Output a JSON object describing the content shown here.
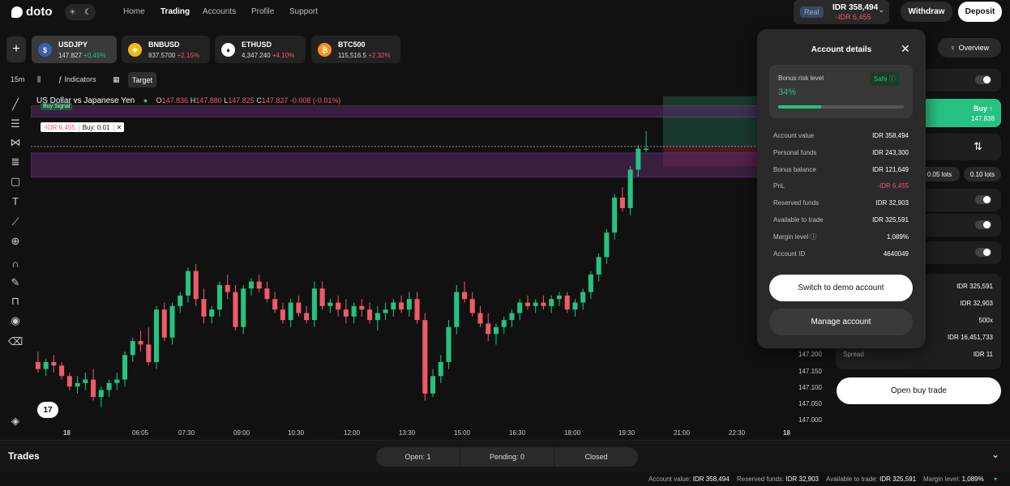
{
  "app": {
    "name": "doto"
  },
  "nav": {
    "items": [
      {
        "label": "Home",
        "active": false
      },
      {
        "label": "Trading",
        "active": true
      },
      {
        "label": "Accounts",
        "active": false
      },
      {
        "label": "Profile",
        "active": false
      },
      {
        "label": "Support",
        "active": false
      }
    ]
  },
  "account": {
    "type": "Real",
    "value": "IDR 358,494",
    "pnl": "-IDR 6,455"
  },
  "header": {
    "withdraw": "Withdraw",
    "deposit": "Deposit"
  },
  "instruments": [
    {
      "symbol": "USDJPY",
      "price": "147.827",
      "change": "+0.45%",
      "change_positive": true,
      "active": true,
      "icon": "us-jp-flag-icon",
      "color": "#3c5fb0"
    },
    {
      "symbol": "BNBUSD",
      "price": "837.5700",
      "change": "+2.15%",
      "change_positive": false,
      "active": false,
      "icon": "bnb-icon",
      "color": "#f0b90b"
    },
    {
      "symbol": "ETHUSD",
      "price": "4,347.240",
      "change": "+4.10%",
      "change_positive": false,
      "active": false,
      "icon": "eth-icon",
      "color": "#ffffff"
    },
    {
      "symbol": "BTC500",
      "price": "115,516.5",
      "change": "+2.32%",
      "change_positive": false,
      "active": false,
      "icon": "btc-icon",
      "color": "#f7931a"
    }
  ],
  "chart_toolbar": {
    "timeframe": "15m",
    "indicators": "Indicators",
    "target": "Target"
  },
  "chart_data": {
    "type": "candlestick",
    "title": "US Dollar vs Japanese Yen",
    "ohlc_label": {
      "o": "147.836",
      "h": "147.880",
      "l": "147.825",
      "c": "147.827",
      "change": "-0.008 (-0.01%)"
    },
    "ylim": [
      147.0,
      148.0
    ],
    "y_ticks": [
      "147.200",
      "147.150",
      "147.100",
      "147.050",
      "147.000"
    ],
    "x_ticks": [
      "18",
      "06:05",
      "07:30",
      "09:00",
      "10:30",
      "12:00",
      "13:30",
      "15:00",
      "16:30",
      "18:00",
      "19:30",
      "21:00",
      "22:30",
      "18"
    ],
    "candles": [
      [
        147.22,
        147.25,
        147.19,
        147.2
      ],
      [
        147.2,
        147.23,
        147.18,
        147.22
      ],
      [
        147.22,
        147.24,
        147.19,
        147.21
      ],
      [
        147.21,
        147.22,
        147.17,
        147.18
      ],
      [
        147.18,
        147.19,
        147.14,
        147.15
      ],
      [
        147.15,
        147.18,
        147.13,
        147.16
      ],
      [
        147.16,
        147.19,
        147.14,
        147.17
      ],
      [
        147.17,
        147.2,
        147.11,
        147.12
      ],
      [
        147.12,
        147.15,
        147.09,
        147.14
      ],
      [
        147.14,
        147.17,
        147.12,
        147.16
      ],
      [
        147.16,
        147.19,
        147.14,
        147.17
      ],
      [
        147.17,
        147.25,
        147.15,
        147.24
      ],
      [
        147.24,
        147.29,
        147.22,
        147.28
      ],
      [
        147.28,
        147.31,
        147.25,
        147.27
      ],
      [
        147.27,
        147.32,
        147.21,
        147.22
      ],
      [
        147.22,
        147.38,
        147.2,
        147.37
      ],
      [
        147.37,
        147.39,
        147.28,
        147.29
      ],
      [
        147.29,
        147.39,
        147.27,
        147.38
      ],
      [
        147.38,
        147.42,
        147.36,
        147.41
      ],
      [
        147.41,
        147.49,
        147.39,
        147.48
      ],
      [
        147.48,
        147.5,
        147.38,
        147.4
      ],
      [
        147.4,
        147.43,
        147.33,
        147.35
      ],
      [
        147.35,
        147.38,
        147.33,
        147.37
      ],
      [
        147.37,
        147.45,
        147.35,
        147.44
      ],
      [
        147.44,
        147.47,
        147.4,
        147.42
      ],
      [
        147.42,
        147.44,
        147.31,
        147.32
      ],
      [
        147.32,
        147.44,
        147.3,
        147.43
      ],
      [
        147.43,
        147.46,
        147.41,
        147.45
      ],
      [
        147.45,
        147.47,
        147.42,
        147.43
      ],
      [
        147.43,
        147.45,
        147.39,
        147.4
      ],
      [
        147.4,
        147.42,
        147.36,
        147.37
      ],
      [
        147.37,
        147.39,
        147.33,
        147.34
      ],
      [
        147.34,
        147.4,
        147.32,
        147.39
      ],
      [
        147.39,
        147.41,
        147.35,
        147.36
      ],
      [
        147.36,
        147.38,
        147.33,
        147.34
      ],
      [
        147.34,
        147.45,
        147.32,
        147.43
      ],
      [
        147.43,
        147.45,
        147.37,
        147.38
      ],
      [
        147.38,
        147.4,
        147.36,
        147.39
      ],
      [
        147.39,
        147.41,
        147.35,
        147.37
      ],
      [
        147.37,
        147.4,
        147.33,
        147.35
      ],
      [
        147.35,
        147.39,
        147.33,
        147.38
      ],
      [
        147.38,
        147.4,
        147.35,
        147.37
      ],
      [
        147.37,
        147.39,
        147.33,
        147.34
      ],
      [
        147.34,
        147.38,
        147.31,
        147.36
      ],
      [
        147.36,
        147.39,
        147.34,
        147.37
      ],
      [
        147.37,
        147.4,
        147.35,
        147.39
      ],
      [
        147.39,
        147.41,
        147.36,
        147.37
      ],
      [
        147.37,
        147.42,
        147.35,
        147.4
      ],
      [
        147.4,
        147.42,
        147.33,
        147.34
      ],
      [
        147.34,
        147.36,
        147.11,
        147.13
      ],
      [
        147.13,
        147.2,
        147.12,
        147.18
      ],
      [
        147.18,
        147.24,
        147.16,
        147.22
      ],
      [
        147.22,
        147.34,
        147.2,
        147.32
      ],
      [
        147.32,
        147.44,
        147.3,
        147.42
      ],
      [
        147.42,
        147.45,
        147.39,
        147.4
      ],
      [
        147.4,
        147.42,
        147.35,
        147.36
      ],
      [
        147.36,
        147.38,
        147.32,
        147.33
      ],
      [
        147.33,
        147.36,
        147.28,
        147.3
      ],
      [
        147.3,
        147.33,
        147.27,
        147.32
      ],
      [
        147.32,
        147.35,
        147.3,
        147.34
      ],
      [
        147.34,
        147.37,
        147.32,
        147.36
      ],
      [
        147.36,
        147.4,
        147.34,
        147.39
      ],
      [
        147.39,
        147.41,
        147.37,
        147.38
      ],
      [
        147.38,
        147.4,
        147.36,
        147.39
      ],
      [
        147.39,
        147.41,
        147.37,
        147.38
      ],
      [
        147.38,
        147.41,
        147.36,
        147.4
      ],
      [
        147.4,
        147.42,
        147.38,
        147.41
      ],
      [
        147.41,
        147.42,
        147.36,
        147.37
      ],
      [
        147.37,
        147.4,
        147.35,
        147.39
      ],
      [
        147.39,
        147.43,
        147.37,
        147.42
      ],
      [
        147.42,
        147.48,
        147.4,
        147.47
      ],
      [
        147.47,
        147.53,
        147.45,
        147.52
      ],
      [
        147.52,
        147.6,
        147.5,
        147.59
      ],
      [
        147.59,
        147.7,
        147.57,
        147.69
      ],
      [
        147.69,
        147.72,
        147.65,
        147.66
      ],
      [
        147.66,
        147.78,
        147.64,
        147.77
      ],
      [
        147.77,
        147.84,
        147.75,
        147.83
      ],
      [
        147.83,
        147.88,
        147.82,
        147.83
      ]
    ],
    "levels": {
      "buy_price": 147.836,
      "tp_top": 147.98,
      "sl_bottom": 147.78
    },
    "buy_signal_label": "Buy Signal",
    "position_label": {
      "pnl": "-IDR 6,455",
      "size": "Buy: 0.01"
    }
  },
  "account_details": {
    "title": "Account details",
    "risk": {
      "label": "Bonus risk level",
      "status": "Safe",
      "percent_text": "34%",
      "fraction": 0.34
    },
    "rows": [
      {
        "label": "Account value",
        "value": "IDR 358,494",
        "neg": false
      },
      {
        "label": "Personal funds",
        "value": "IDR 243,300",
        "neg": false
      },
      {
        "label": "Bonus balance",
        "value": "IDR 121,649",
        "neg": false
      },
      {
        "label": "PnL",
        "value": "-IDR 6,455",
        "neg": true
      },
      {
        "label": "Reserved funds",
        "value": "IDR 32,903",
        "neg": false
      },
      {
        "label": "Available to trade",
        "value": "IDR 325,591",
        "neg": false
      },
      {
        "label": "Margin level",
        "value": "1,089%",
        "neg": false
      },
      {
        "label": "Account ID",
        "value": "4640049",
        "neg": false
      }
    ],
    "switch_demo": "Switch to demo account",
    "manage": "Manage account"
  },
  "right_panel": {
    "overview": "Overview",
    "buy_label": "Buy",
    "buy_price": "147.838",
    "lots": [
      "0.05 lots",
      "0.10 lots"
    ],
    "info": [
      {
        "label": "",
        "value": "IDR 325,591"
      },
      {
        "label": "",
        "value": "IDR 32,903"
      },
      {
        "label": "",
        "value": "500x"
      },
      {
        "label": "",
        "value": "IDR 16,451,733"
      },
      {
        "label": "Spread",
        "value": "IDR 11"
      }
    ],
    "open_buy": "Open buy trade"
  },
  "trades": {
    "title": "Trades",
    "tabs": [
      "Open: 1",
      "Pending: 0",
      "Closed"
    ]
  },
  "status_bar": [
    {
      "label": "Account value:",
      "value": "IDR 358,494"
    },
    {
      "label": "Reserved funds:",
      "value": "IDR 32,903"
    },
    {
      "label": "Available to trade:",
      "value": "IDR 325,591"
    },
    {
      "label": "Margin level:",
      "value": "1,089%"
    }
  ],
  "colors": {
    "up": "#26c281",
    "down": "#ef5b67",
    "accent": "#26c281"
  }
}
